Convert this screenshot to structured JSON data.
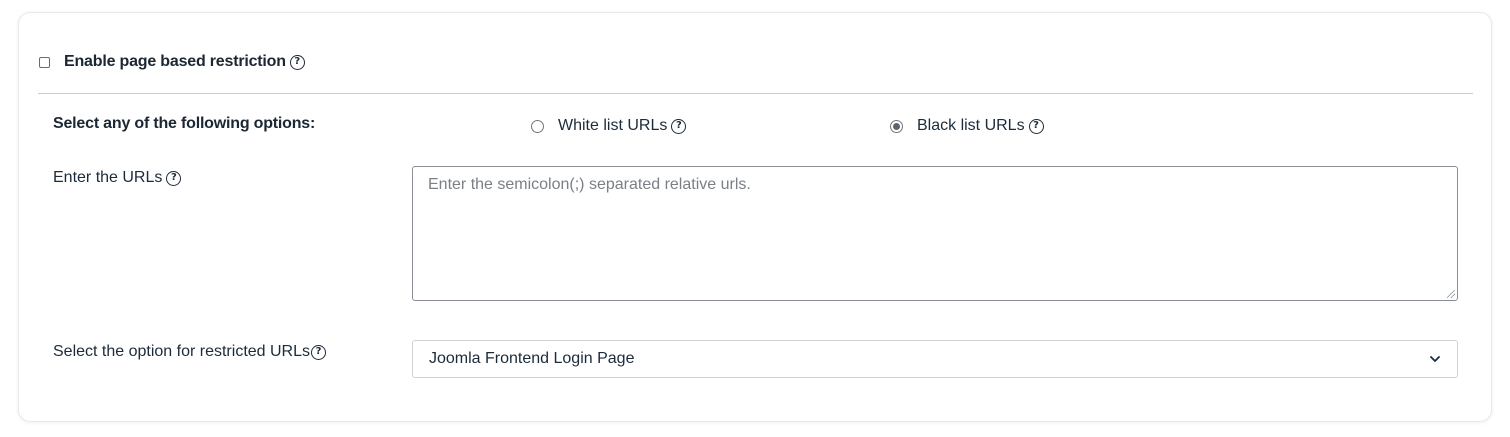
{
  "restriction": {
    "enable_label": "Enable page based restriction",
    "enable_checked": false
  },
  "options": {
    "label": "Select any of the following options:",
    "white_list_label": "White list URLs",
    "black_list_label": "Black list URLs",
    "selected": "black_list"
  },
  "urls": {
    "label": "Enter the URLs",
    "placeholder": "Enter the semicolon(;) separated relative urls.",
    "value": ""
  },
  "restricted_option": {
    "label": "Select the option for restricted URLs",
    "selected_value": "Joomla Frontend Login Page"
  },
  "icons": {
    "help": "question-circle-icon",
    "help_glyph": "?",
    "dropdown": "chevron-down-icon"
  }
}
